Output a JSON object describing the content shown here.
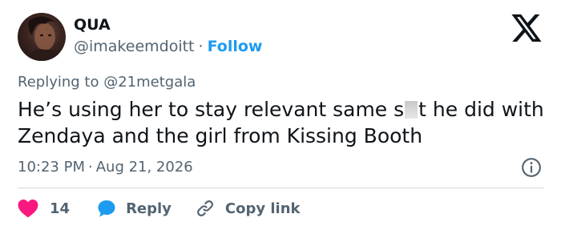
{
  "author": {
    "name": "QUA",
    "handle": "@imakeemdoitt",
    "separator": "·",
    "follow_label": "Follow"
  },
  "reply_context": {
    "prefix": "Replying to ",
    "mention": "@21metgala"
  },
  "tweet": {
    "text_before_censor": "He’s using her to stay relevant same s",
    "text_after_censor": "t he did with Zendaya and the girl from Kissing Booth"
  },
  "meta": {
    "time": "10:23 PM",
    "separator": "·",
    "date": "Aug 21, 2026"
  },
  "actions": {
    "likes_count": "14",
    "reply_label": "Reply",
    "copy_link_label": "Copy link"
  },
  "colors": {
    "accent": "#1d9bf0",
    "like": "#f91880",
    "muted": "#536471",
    "text": "#0f1419",
    "divider": "#cfd9de"
  },
  "icons": [
    "x-logo-icon",
    "info-icon",
    "heart-icon",
    "reply-bubble-icon",
    "link-icon"
  ]
}
